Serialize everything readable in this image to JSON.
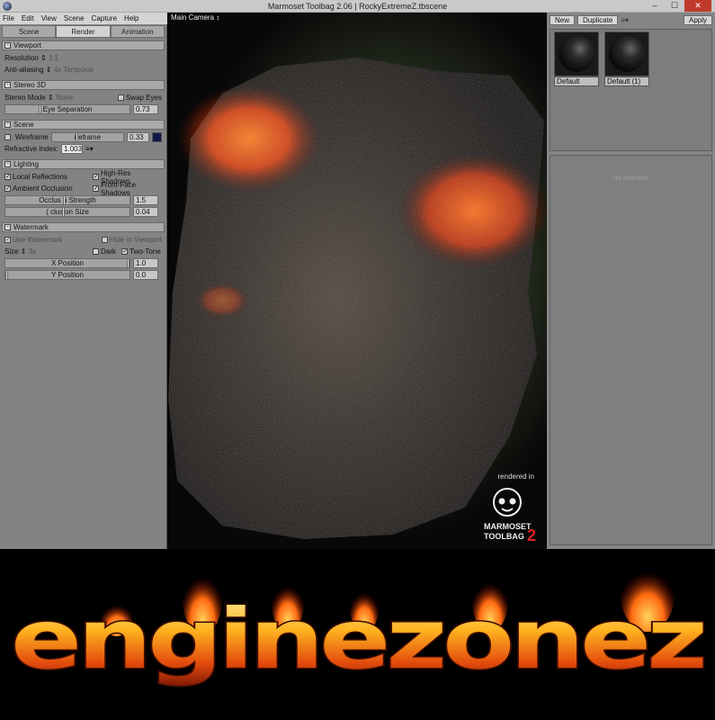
{
  "window": {
    "title": "Marmoset Toolbag 2.06  |  RockyExtremeZ.tbscene",
    "min": "–",
    "max": "☐",
    "close": "✕"
  },
  "menu": [
    "File",
    "Edit",
    "View",
    "Scene",
    "Capture",
    "Help"
  ],
  "tabs": {
    "scene": "Scene",
    "render": "Render",
    "animation": "Animation",
    "active": "render"
  },
  "viewport_section": {
    "title": "Viewport",
    "resolution_label": "Resolution",
    "resolution_value": "1:1",
    "aa_label": "Anti-aliasing",
    "aa_value": "4x Temporal"
  },
  "stereo_section": {
    "title": "Stereo 3D",
    "mode_label": "Stereo Mode",
    "mode_value": "None",
    "swap_label": "Swap Eyes",
    "sep_label": "Eye Separation",
    "sep_value": "0.73"
  },
  "scene_section": {
    "title": "Scene",
    "wireframe_label": "Wireframe",
    "wireframe_slider": "ireframe",
    "wireframe_value": "0.33",
    "refr_label": "Refractive Index:",
    "refr_value": "1.003"
  },
  "lighting_section": {
    "title": "Lighting",
    "local_reflections": "Local Reflections",
    "high_res_shadows": "High-Res Shadows",
    "ambient_occlusion": "Ambient Occlusion",
    "front_face_shadows": "Front-Face Shadows",
    "occ_strength_label": "Occlus  n Strength",
    "occ_strength_value": "1.5",
    "occ_size_label": "(  clusion Size",
    "occ_size_value": "0.04"
  },
  "watermark_section": {
    "title": "Watermark",
    "use_label": "Use Watermark",
    "hide_label": "Hide in Viewport",
    "size_label": "Size",
    "size_value": "3x",
    "dark_label": "Dark",
    "two_tone_label": "Two-Tone",
    "xpos_label": "X Position",
    "xpos_value": "1.0",
    "ypos_label": "Y Position",
    "ypos_value": "0.0"
  },
  "viewport": {
    "camera_label": "Main Camera ↕",
    "rendered_in": "rendered in",
    "logo_line1": "MARMOSET",
    "logo_line2": "TOOLBAG",
    "logo_num": "2"
  },
  "materials": {
    "new_btn": "New",
    "duplicate_btn": "Duplicate",
    "apply_btn": "Apply",
    "items": [
      "Default",
      "Default (1)"
    ],
    "no_selection": "No Selection"
  },
  "banner": {
    "text": "enginezonez"
  }
}
